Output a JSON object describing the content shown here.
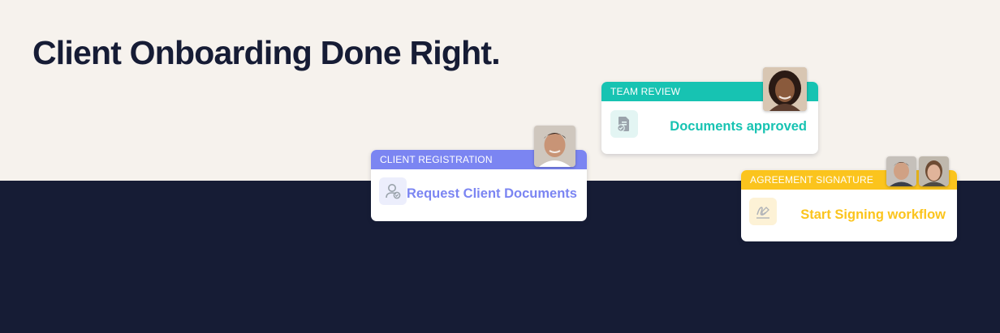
{
  "headline": "Client Onboarding Done Right.",
  "colors": {
    "background_top": "#f6f2ed",
    "background_bottom": "#161c35",
    "registration_accent": "#7b85f2",
    "review_accent": "#17c3b2",
    "signature_accent": "#fbc41d"
  },
  "cards": {
    "registration": {
      "header": "CLIENT REGISTRATION",
      "action": "Request Client Documents",
      "icon": "user-check-icon"
    },
    "review": {
      "header": "TEAM REVIEW",
      "action": "Documents approved",
      "icon": "document-approved-icon"
    },
    "signature": {
      "header": "AGREEMENT SIGNATURE",
      "action": "Start Signing workflow",
      "icon": "signature-icon"
    }
  }
}
